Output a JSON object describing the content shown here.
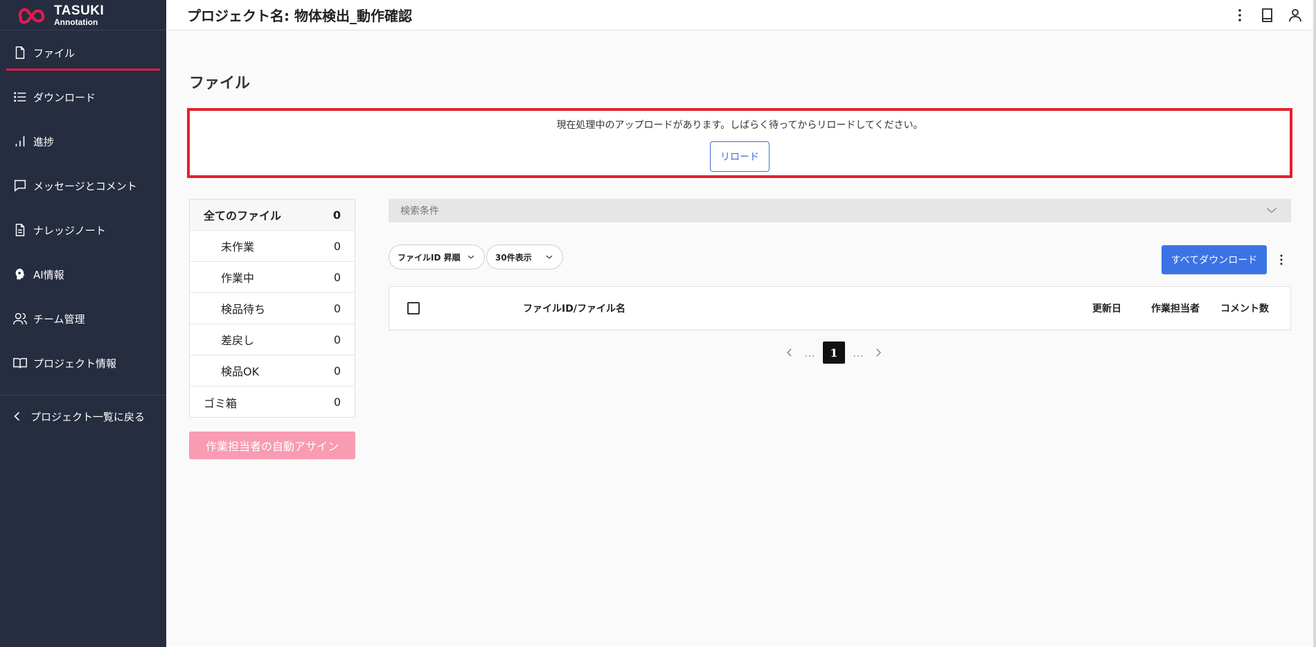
{
  "app": {
    "logo_line1": "TASUKI",
    "logo_line2": "Annotation",
    "brand_color": "#e8194f"
  },
  "header": {
    "project_title": "プロジェクト名: 物体検出_動作確認",
    "actions": [
      "more-vertical-icon",
      "book-icon",
      "user-icon"
    ]
  },
  "sidebar": {
    "items": [
      {
        "label": "ファイル",
        "icon": "file-icon",
        "active": true
      },
      {
        "label": "ダウンロード",
        "icon": "list-icon"
      },
      {
        "label": "進捗",
        "icon": "bar-chart-icon"
      },
      {
        "label": "メッセージとコメント",
        "icon": "message-icon"
      },
      {
        "label": "ナレッジノート",
        "icon": "document-icon"
      },
      {
        "label": "AI情報",
        "icon": "ai-head-icon"
      },
      {
        "label": "チーム管理",
        "icon": "users-icon"
      },
      {
        "label": "プロジェクト情報",
        "icon": "open-book-icon"
      }
    ],
    "back_label": "プロジェクト一覧に戻る"
  },
  "main": {
    "page_title": "ファイル",
    "alert": {
      "message": "現在処理中のアップロードがあります。しばらく待ってからリロードしてください。",
      "reload_label": "リロード",
      "border_color": "#e3212f"
    },
    "status_filters": [
      {
        "label": "全てのファイル",
        "count": "0"
      },
      {
        "label": "未作業",
        "count": "0"
      },
      {
        "label": "作業中",
        "count": "0"
      },
      {
        "label": "検品待ち",
        "count": "0"
      },
      {
        "label": "差戻し",
        "count": "0"
      },
      {
        "label": "検品OK",
        "count": "0"
      },
      {
        "label": "ゴミ箱",
        "count": "0"
      }
    ],
    "auto_assign_label": "作業担当者の自動アサイン",
    "search_label": "検索条件",
    "sort_select": "ファイルID 昇順",
    "count_select": "30件表示",
    "download_all_label": "すべてダウンロード",
    "table": {
      "columns": [
        "ファイルID/ファイル名",
        "更新日",
        "作業担当者",
        "コメント数"
      ]
    },
    "pagination": {
      "ellipsis": "…",
      "current_page": "1"
    }
  }
}
